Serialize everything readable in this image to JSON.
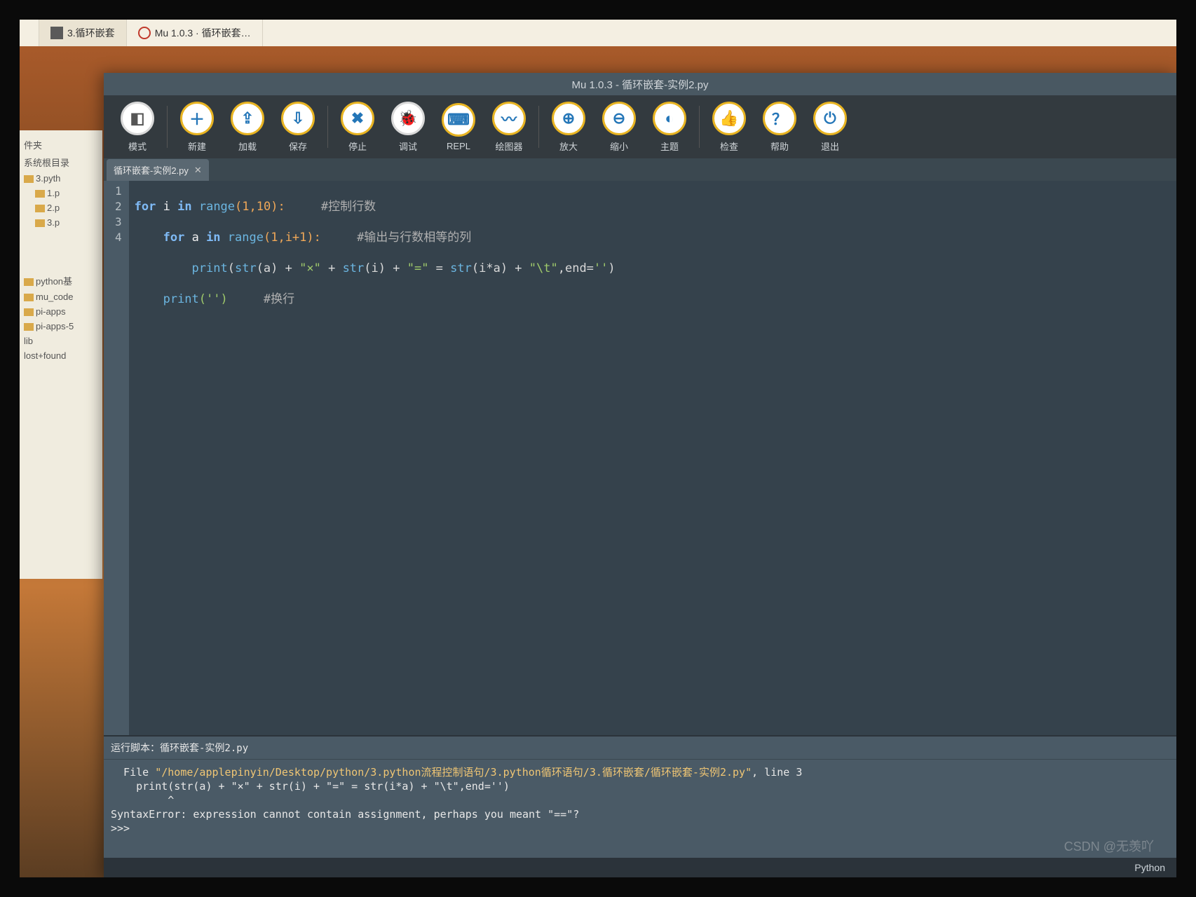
{
  "taskbar": {
    "items": [
      {
        "label": "3.循环嵌套"
      },
      {
        "label": "Mu 1.0.3 · 循环嵌套…"
      }
    ]
  },
  "fileManager": {
    "header1": "件夹",
    "header2": "系统根目录",
    "items": [
      "3.pyth",
      "1.p",
      "2.p",
      "3.p",
      "python基",
      "mu_code",
      "pi-apps",
      "pi-apps-5",
      "lib",
      "lost+found"
    ]
  },
  "mu": {
    "title": "Mu 1.0.3 - 循环嵌套-实例2.py",
    "toolbar": [
      {
        "name": "mode",
        "label": "模式",
        "glyph": "◧",
        "grey": true
      },
      {
        "name": "new",
        "label": "新建",
        "glyph": "＋"
      },
      {
        "name": "load",
        "label": "加载",
        "glyph": "⇪"
      },
      {
        "name": "save",
        "label": "保存",
        "glyph": "⇩"
      },
      {
        "name": "stop",
        "label": "停止",
        "glyph": "✖"
      },
      {
        "name": "debug",
        "label": "调试",
        "glyph": "🐞",
        "grey": true
      },
      {
        "name": "repl",
        "label": "REPL",
        "glyph": "⌨"
      },
      {
        "name": "plot",
        "label": "绘图器",
        "glyph": "〰"
      },
      {
        "name": "zoomin",
        "label": "放大",
        "glyph": "⊕"
      },
      {
        "name": "zoomout",
        "label": "缩小",
        "glyph": "⊖"
      },
      {
        "name": "theme",
        "label": "主题",
        "glyph": "◐"
      },
      {
        "name": "check",
        "label": "检查",
        "glyph": "👍"
      },
      {
        "name": "help",
        "label": "帮助",
        "glyph": "？"
      },
      {
        "name": "quit",
        "label": "退出",
        "glyph": "⏻"
      }
    ],
    "tab": {
      "label": "循环嵌套-实例2.py",
      "close": "✕"
    },
    "code": {
      "lines": [
        "1",
        "2",
        "3",
        "4"
      ],
      "l1": {
        "kw1": "for",
        "v1": "i",
        "kw2": "in",
        "fn": "range",
        "args": "(1,10):",
        "cmt": "#控制行数"
      },
      "l2": {
        "kw1": "for",
        "v1": "a",
        "kw2": "in",
        "fn": "range",
        "args": "(1,i+1):",
        "cmt": "#输出与行数相等的列"
      },
      "l3": {
        "fn": "print",
        "open": "(",
        "fn2": "str",
        "a": "(a)",
        "op1": " + ",
        "s1": "\"×\"",
        "op2": " + ",
        "fn3": "str",
        "i": "(i)",
        "op3": " + ",
        "s2": "\"=\"",
        "op4": " = ",
        "fn4": "str",
        "ia": "(i*a)",
        "op5": " + ",
        "s3": "\"\\t\"",
        "endkw": ",end=",
        "endv": "''",
        "close": ")"
      },
      "l4": {
        "fn": "print",
        "args": "('')",
        "cmt": "#换行"
      }
    },
    "repl": {
      "header": "运行脚本：循环嵌套-实例2.py",
      "line1a": "  File ",
      "line1b": "\"/home/applepinyin/Desktop/python/3.python流程控制语句/3.python循环语句/3.循环嵌套/循环嵌套-实例2.py\"",
      "line1c": ", line 3",
      "line2": "    print(str(a) + \"×\" + str(i) + \"=\" = str(i*a) + \"\\t\",end='')",
      "line3": "         ^",
      "line4": "SyntaxError: expression cannot contain assignment, perhaps you meant \"==\"?",
      "prompt": ">>> "
    },
    "status": "Python"
  },
  "watermark": "CSDN @无羡吖"
}
